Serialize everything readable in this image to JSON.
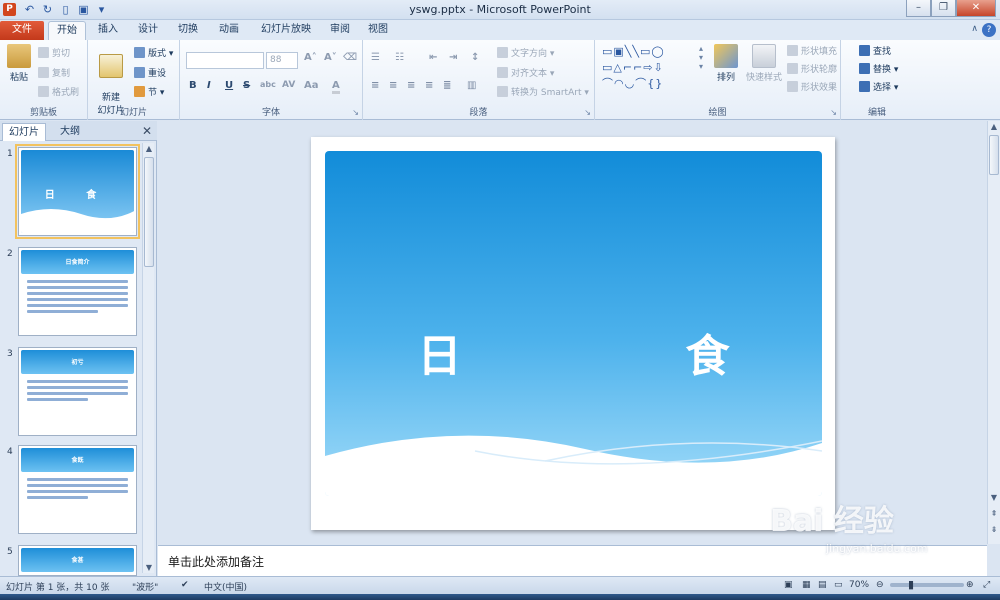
{
  "window": {
    "title": "yswg.pptx - Microsoft PowerPoint",
    "app_icon": "P",
    "controls": [
      "–",
      "❐",
      "✕"
    ],
    "help": "?"
  },
  "ribbon_tabs": [
    "文件",
    "开始",
    "插入",
    "设计",
    "切换",
    "动画",
    "幻灯片放映",
    "审阅",
    "视图"
  ],
  "clipboard": {
    "label": "剪贴板",
    "paste": "粘贴",
    "cut": "剪切",
    "copy": "复制",
    "format_painter": "格式刷"
  },
  "slides_group": {
    "label": "幻灯片",
    "new_slide": "新建\n幻灯片",
    "layout": "版式",
    "reset": "重设",
    "section": "节"
  },
  "font_group": {
    "label": "字体",
    "size": "88",
    "bold": "B",
    "italic": "I",
    "underline": "U",
    "strike": "S",
    "shadow": "abc",
    "spacing": "AV",
    "case": "Aa",
    "color": "A"
  },
  "paragraph_group": {
    "label": "段落",
    "text_direction": "文字方向",
    "align_text": "对齐文本",
    "smartart": "转换为 SmartArt"
  },
  "drawing_group": {
    "label": "绘图",
    "arrange": "排列",
    "quick_styles": "快速样式",
    "fill": "形状填充",
    "outline": "形状轮廓",
    "effects": "形状效果"
  },
  "editing_group": {
    "label": "编辑",
    "find": "查找",
    "replace": "替换",
    "select": "选择"
  },
  "left_pane": {
    "tabs": [
      "幻灯片",
      "大纲"
    ],
    "close": "✕",
    "slides": [
      {
        "num": "1",
        "title": "日 食"
      },
      {
        "num": "2",
        "title": "日食简介"
      },
      {
        "num": "3",
        "title": "初亏"
      },
      {
        "num": "4",
        "title": "食既"
      },
      {
        "num": "5",
        "title": "食甚"
      }
    ]
  },
  "slide": {
    "title": "日　食"
  },
  "notes": {
    "placeholder": "单击此处添加备注"
  },
  "status": {
    "slide_info": "幻灯片 第 1 张，共 10 张",
    "theme": "\"波形\"",
    "language": "中文(中国)",
    "zoom": "70%"
  },
  "watermark": {
    "text": "Bai 经验",
    "url": "jingyan.baidu.com"
  },
  "colors": {
    "file_tab": "#c3391b",
    "slide_sky_top": "#128cd9",
    "slide_sky_bottom": "#a2dcf9",
    "selection": "#f2c25e"
  }
}
